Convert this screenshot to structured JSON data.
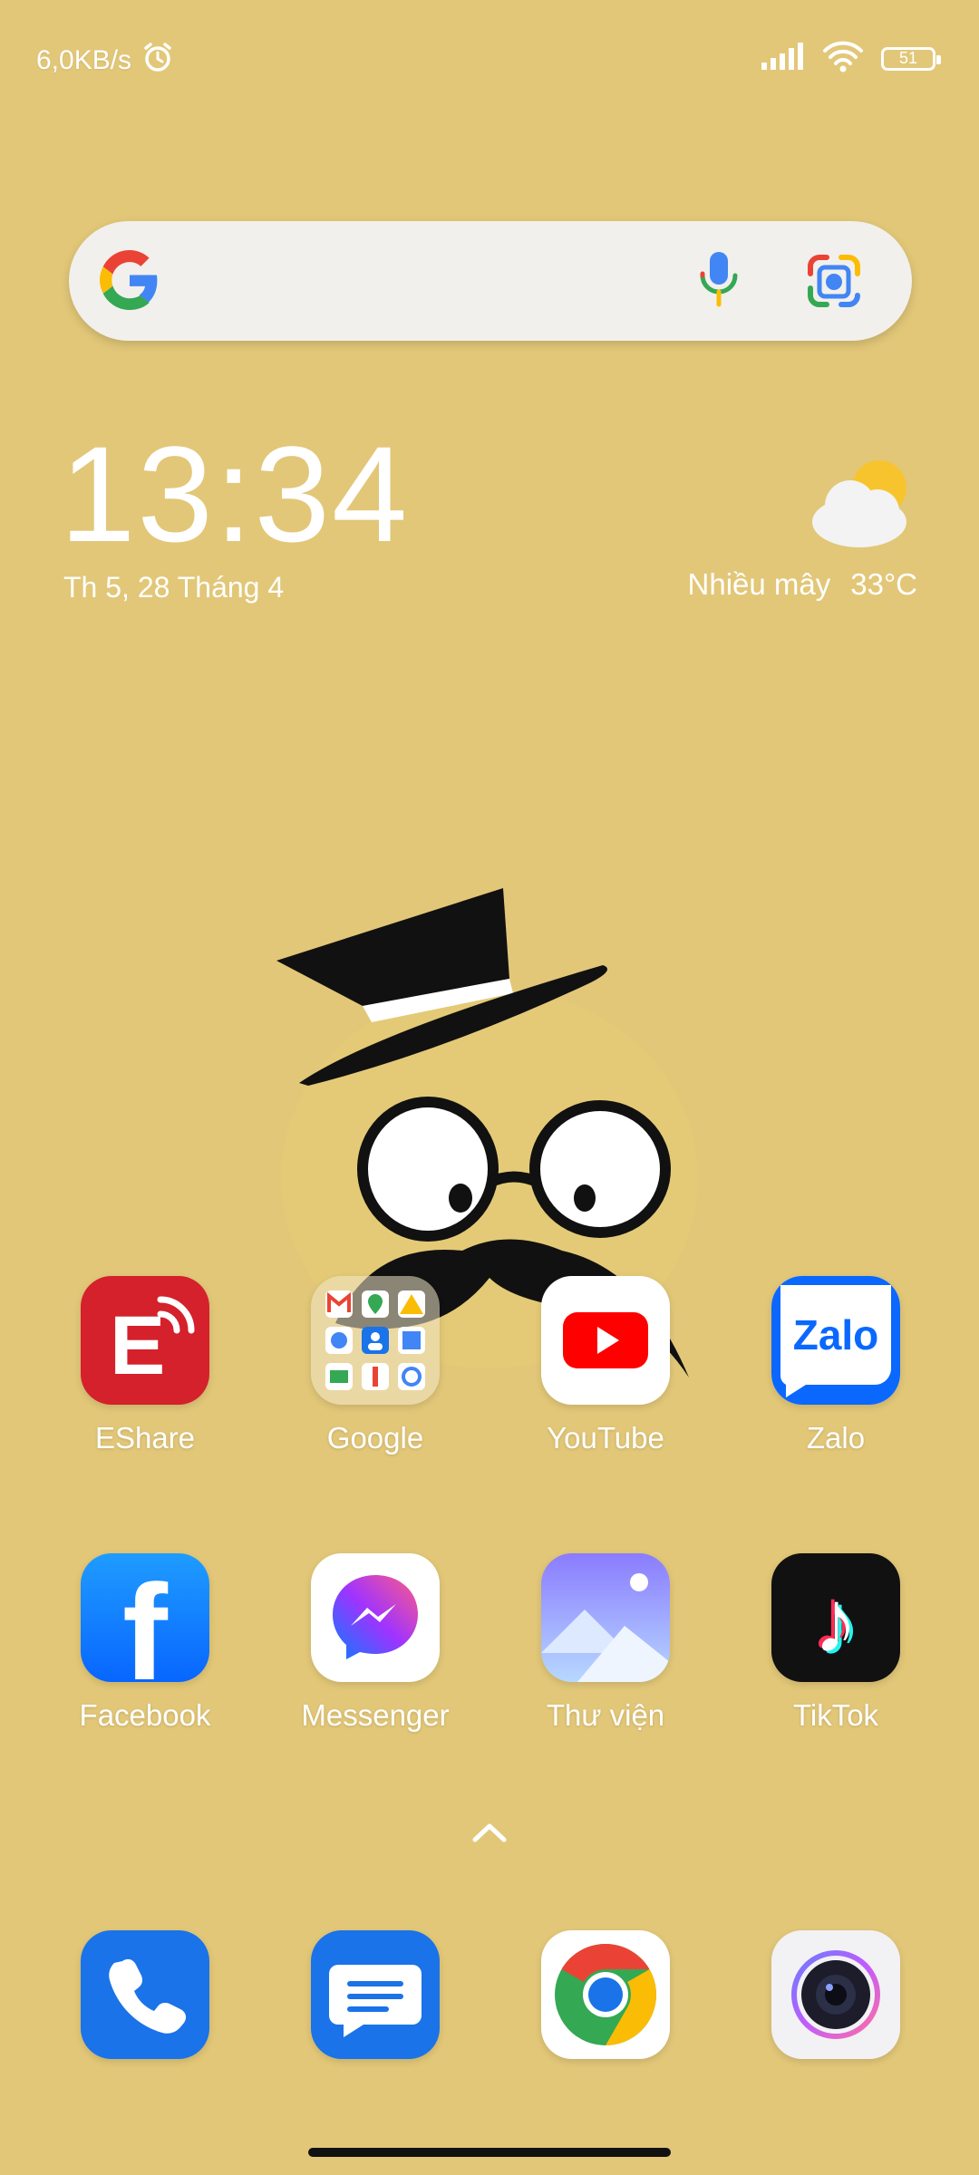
{
  "status_bar": {
    "speed": "6,0KB/s",
    "battery": "51"
  },
  "search": {
    "engine_icon": "google-g-icon",
    "mic_icon": "mic-icon",
    "lens_icon": "lens-icon"
  },
  "clock": {
    "time": "13:34",
    "date": "Th 5, 28 Tháng 4"
  },
  "weather": {
    "condition": "Nhiều mây",
    "temp": "33°C",
    "icon": "partly-cloudy-icon"
  },
  "apps_row1": [
    {
      "label": "EShare",
      "icon": "eshare-icon"
    },
    {
      "label": "Google",
      "icon": "google-folder-icon"
    },
    {
      "label": "YouTube",
      "icon": "youtube-icon"
    },
    {
      "label": "Zalo",
      "icon": "zalo-icon",
      "icon_text": "Zalo"
    }
  ],
  "apps_row2": [
    {
      "label": "Facebook",
      "icon": "facebook-icon",
      "icon_text": "f"
    },
    {
      "label": "Messenger",
      "icon": "messenger-icon"
    },
    {
      "label": "Thư viện",
      "icon": "gallery-icon"
    },
    {
      "label": "TikTok",
      "icon": "tiktok-icon",
      "icon_text": "♪"
    }
  ],
  "dock": [
    {
      "icon": "phone-icon"
    },
    {
      "icon": "messages-icon"
    },
    {
      "icon": "chrome-icon"
    },
    {
      "icon": "camera-icon"
    }
  ],
  "colors": {
    "wallpaper": "#e2c778",
    "accent_blue": "#1a73e8"
  }
}
